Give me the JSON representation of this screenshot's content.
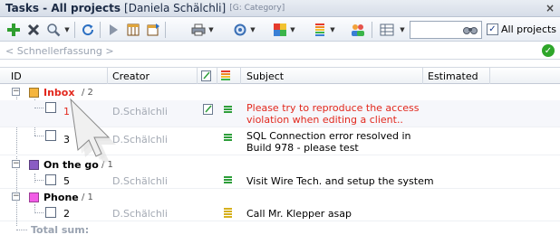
{
  "window": {
    "title": "Tasks - All projects",
    "user": "[Daniela Schälchli]",
    "category": "[G: Category]",
    "close_glyph": "×"
  },
  "toolbar": {
    "search_value": "",
    "all_projects_label": "All projects",
    "all_projects_checked": "✓"
  },
  "quick_entry": {
    "placeholder": "< Schnellerfassung >",
    "ok_glyph": "✓"
  },
  "columns": {
    "id": "ID",
    "creator": "Creator",
    "subject": "Subject",
    "estimated": "Estimated"
  },
  "groups": [
    {
      "name": "Inbox",
      "count": "/ 2",
      "color": "#f5b53d",
      "name_color": "#e2281d",
      "tasks": [
        {
          "id": "1",
          "creator": "D.Schälchli",
          "subject": "Please try to reproduce the access violation when editing a client..",
          "subject_color": "#e2281d",
          "has_note": true,
          "priority": "green"
        },
        {
          "id": "3",
          "creator": "D.Schälchli",
          "subject": "SQL Connection error resolved in Build 978 - please test",
          "subject_color": "#000000",
          "has_note": false,
          "priority": "green"
        }
      ]
    },
    {
      "name": "On the go",
      "count": "/ 1",
      "color": "#8a5cc4",
      "name_color": "#000000",
      "tasks": [
        {
          "id": "5",
          "creator": "D.Schälchli",
          "subject": "Visit Wire Tech. and setup the system",
          "subject_color": "#000000",
          "has_note": false,
          "priority": "green"
        }
      ]
    },
    {
      "name": "Phone",
      "count": "/ 1",
      "color": "#f25ce6",
      "name_color": "#000000",
      "tasks": [
        {
          "id": "2",
          "creator": "D.Schälchli",
          "subject": "Call Mr. Klepper asap",
          "subject_color": "#000000",
          "has_note": false,
          "priority": "yellow"
        }
      ]
    }
  ],
  "footer": {
    "total_label": "Total sum:"
  },
  "colors": {
    "accent_red": "#e2281d",
    "priority_green": "#2e9e3a",
    "priority_yellow": "#d6b01c",
    "ok_green": "#2fa62a"
  }
}
